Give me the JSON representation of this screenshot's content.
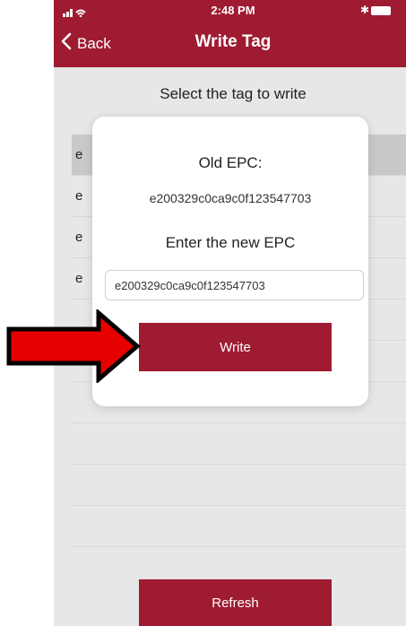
{
  "status_bar": {
    "time": "2:48 PM",
    "signal_icon": "signal-wifi-icon",
    "bluetooth_icon": "bluetooth-icon",
    "battery_icon": "battery-icon"
  },
  "nav": {
    "back_label": "Back",
    "title": "Write Tag"
  },
  "page": {
    "subtitle": "Select the tag to write"
  },
  "tag_list": {
    "items": [
      "e",
      "e",
      "e",
      "e"
    ]
  },
  "dialog": {
    "old_label": "Old EPC:",
    "old_value": "e200329c0ca9c0f123547703",
    "enter_label": "Enter the new EPC",
    "input_value": "e200329c0ca9c0f123547703",
    "write_label": "Write"
  },
  "refresh_label": "Refresh",
  "colors": {
    "brand": "#9e1b32",
    "arrow": "#e60000"
  }
}
